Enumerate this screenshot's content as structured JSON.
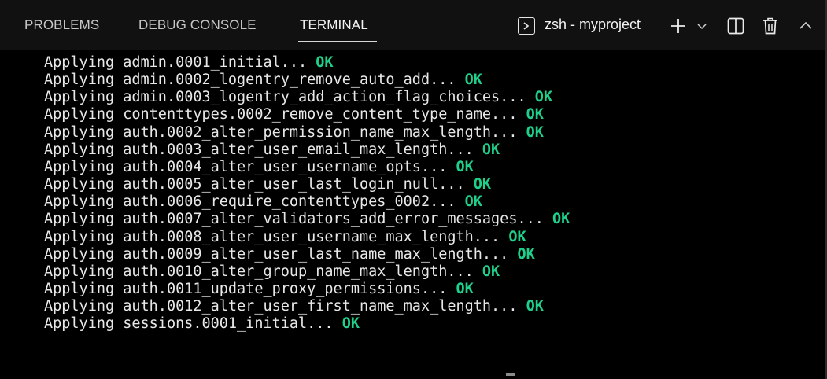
{
  "tabs": [
    {
      "label": "PROBLEMS",
      "active": false
    },
    {
      "label": "DEBUG CONSOLE",
      "active": false
    },
    {
      "label": "TERMINAL",
      "active": true
    }
  ],
  "terminal_selector": {
    "icon": "terminal-icon",
    "name": "zsh - myproject"
  },
  "toolbar_icons": [
    "plus-icon",
    "chevron-down-icon",
    "split-terminal-icon",
    "trash-icon",
    "chevron-up-icon"
  ],
  "colors": {
    "background": "#000000",
    "tabbar": "#111111",
    "text": "#e8e8e8",
    "ok": "#1fd08b"
  },
  "output": {
    "prefix": "Applying",
    "status": "OK",
    "lines": [
      "admin.0001_initial...",
      "admin.0002_logentry_remove_auto_add...",
      "admin.0003_logentry_add_action_flag_choices...",
      "contenttypes.0002_remove_content_type_name...",
      "auth.0002_alter_permission_name_max_length...",
      "auth.0003_alter_user_email_max_length...",
      "auth.0004_alter_user_username_opts...",
      "auth.0005_alter_user_last_login_null...",
      "auth.0006_require_contenttypes_0002...",
      "auth.0007_alter_validators_add_error_messages...",
      "auth.0008_alter_user_username_max_length...",
      "auth.0009_alter_user_last_name_max_length...",
      "auth.0010_alter_group_name_max_length...",
      "auth.0011_update_proxy_permissions...",
      "auth.0012_alter_user_first_name_max_length...",
      "sessions.0001_initial..."
    ]
  }
}
